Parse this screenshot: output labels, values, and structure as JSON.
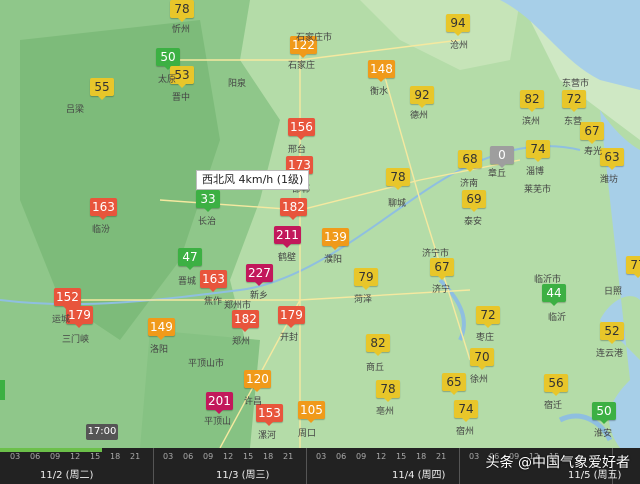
{
  "colors": {
    "green": "#3cb043",
    "yellow": "#e8c62a",
    "orange": "#f09a1a",
    "red": "#e8553c",
    "purple": "#c2185b",
    "gray": "#9e9e9e"
  },
  "markers": [
    {
      "value": "78",
      "level": "yellow"
    },
    {
      "value": "50",
      "level": "green"
    },
    {
      "value": "53",
      "level": "yellow"
    },
    {
      "value": "55",
      "level": "yellow"
    },
    {
      "value": "122",
      "level": "orange"
    },
    {
      "value": "94",
      "level": "yellow"
    },
    {
      "value": "148",
      "level": "orange"
    },
    {
      "value": "92",
      "level": "yellow"
    },
    {
      "value": "82",
      "level": "yellow"
    },
    {
      "value": "72",
      "level": "yellow"
    },
    {
      "value": "67",
      "level": "yellow"
    },
    {
      "value": "156",
      "level": "red"
    },
    {
      "value": "74",
      "level": "yellow"
    },
    {
      "value": "0",
      "level": "gray"
    },
    {
      "value": "68",
      "level": "yellow"
    },
    {
      "value": "63",
      "level": "yellow"
    },
    {
      "value": "173",
      "level": "red"
    },
    {
      "value": "78",
      "level": "yellow"
    },
    {
      "value": "163",
      "level": "red"
    },
    {
      "value": "33",
      "level": "green"
    },
    {
      "value": "182",
      "level": "red"
    },
    {
      "value": "69",
      "level": "yellow"
    },
    {
      "value": "211",
      "level": "purple"
    },
    {
      "value": "139",
      "level": "orange"
    },
    {
      "value": "47",
      "level": "green"
    },
    {
      "value": "163",
      "level": "red"
    },
    {
      "value": "227",
      "level": "purple"
    },
    {
      "value": "79",
      "level": "yellow"
    },
    {
      "value": "67",
      "level": "yellow"
    },
    {
      "value": "77",
      "level": "yellow"
    },
    {
      "value": "44",
      "level": "green"
    },
    {
      "value": "152",
      "level": "red"
    },
    {
      "value": "179",
      "level": "red"
    },
    {
      "value": "149",
      "level": "orange"
    },
    {
      "value": "182",
      "level": "red"
    },
    {
      "value": "179",
      "level": "red"
    },
    {
      "value": "72",
      "level": "yellow"
    },
    {
      "value": "52",
      "level": "yellow"
    },
    {
      "value": "82",
      "level": "yellow"
    },
    {
      "value": "70",
      "level": "yellow"
    },
    {
      "value": "120",
      "level": "orange"
    },
    {
      "value": "65",
      "level": "yellow"
    },
    {
      "value": "56",
      "level": "yellow"
    },
    {
      "value": "201",
      "level": "purple"
    },
    {
      "value": "153",
      "level": "red"
    },
    {
      "value": "105",
      "level": "orange"
    },
    {
      "value": "78",
      "level": "yellow"
    },
    {
      "value": "74",
      "level": "yellow"
    },
    {
      "value": "50",
      "level": "green"
    }
  ],
  "cities": [
    "忻州",
    "太原",
    "晋中",
    "吕梁",
    "阳泉",
    "石家庄市",
    "石家庄",
    "衡水",
    "沧州",
    "德州",
    "滨州",
    "东营市",
    "东营",
    "淄博",
    "寿光",
    "潍坊",
    "邢台",
    "章丘",
    "莱芜市",
    "济南",
    "邯郸",
    "聊城",
    "泰安",
    "临汾",
    "长治",
    "鹤壁",
    "濮阳",
    "济宁市",
    "济宁",
    "晋城",
    "焦作",
    "新乡",
    "菏泽",
    "临沂市",
    "临沂",
    "运城",
    "三门峡",
    "洛阳",
    "郑州市",
    "郑州",
    "开封",
    "枣庄",
    "日照",
    "商丘",
    "徐州",
    "连云港",
    "平顶山市",
    "许昌",
    "亳州",
    "宿迁",
    "平顶山",
    "漯河",
    "周口",
    "宿州",
    "淮安"
  ],
  "tooltip": "西北风 4km/h (1级)",
  "timeline": {
    "current_time": "17:00",
    "progress": 0.16,
    "ticks": [
      "03",
      "06",
      "09",
      "12",
      "15",
      "18",
      "21",
      "03",
      "06",
      "09",
      "12",
      "15",
      "18",
      "21",
      "03",
      "06",
      "09",
      "12",
      "15",
      "18",
      "21",
      "03",
      "06",
      "09",
      "12",
      "15"
    ],
    "days": [
      "11/2 (周二)",
      "11/3 (周三)",
      "11/4 (周四)",
      "11/5 (周五)"
    ]
  },
  "watermark": "头条 @中国气象爱好者"
}
